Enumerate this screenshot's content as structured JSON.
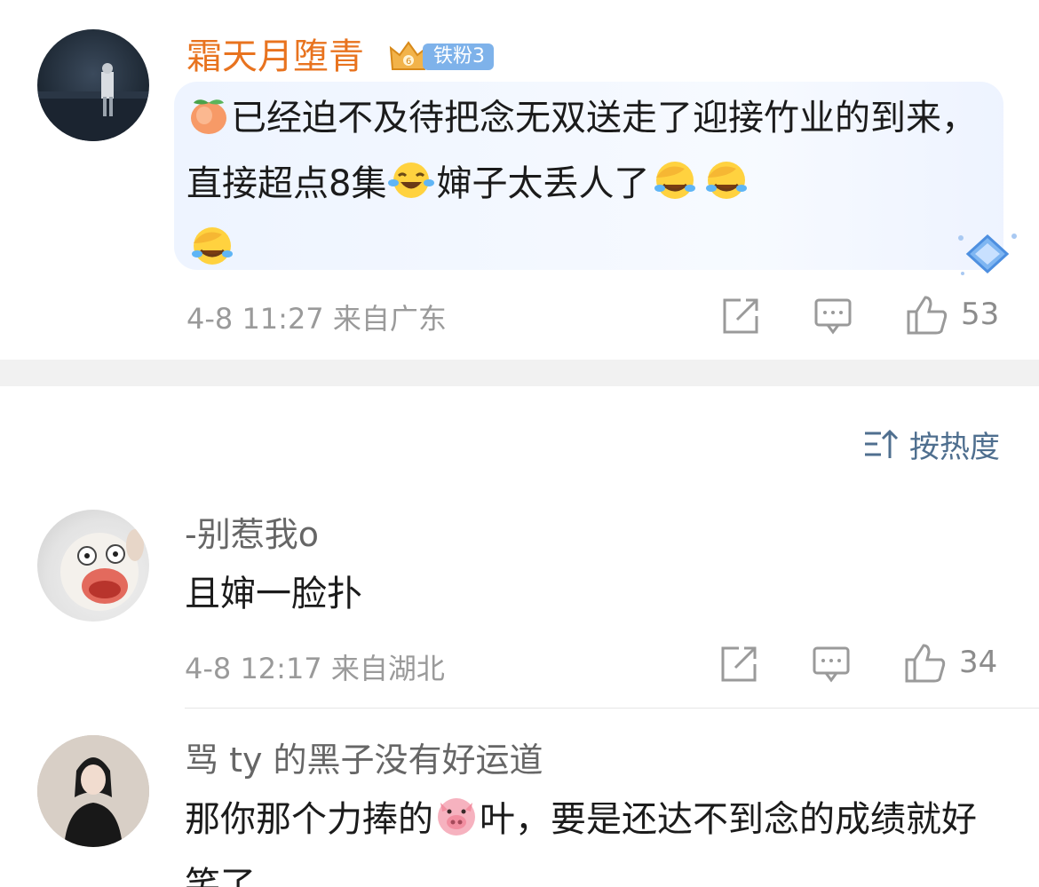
{
  "comments": [
    {
      "username": "霜天月堕青",
      "badge": "铁粉3",
      "content_parts": [
        "已经迫不及待把念无双送走了迎接竹业的到来，直接超点8集",
        "婶子太丢人了"
      ],
      "timestamp": "4-8 11:27",
      "location": "来自广东",
      "likes": "53",
      "emojis": [
        "peach-emoji",
        "laughing-crying-emoji",
        "facepalm-laugh-emoji"
      ],
      "username_color": "#e8731f"
    },
    {
      "username": "-别惹我o",
      "content": "且婶一脸扑",
      "timestamp": "4-8 12:17",
      "location": "来自湖北",
      "likes": "34"
    },
    {
      "username": "骂 ty 的黑子没有好运道",
      "content_parts": [
        "那你那个力捧的",
        "叶，要是还达不到念的成绩就好笑了"
      ],
      "emojis": [
        "pig-emoji"
      ]
    }
  ],
  "sort": {
    "label": "按热度",
    "icon": "sort-icon"
  },
  "accent_color": "#4f6f8f"
}
